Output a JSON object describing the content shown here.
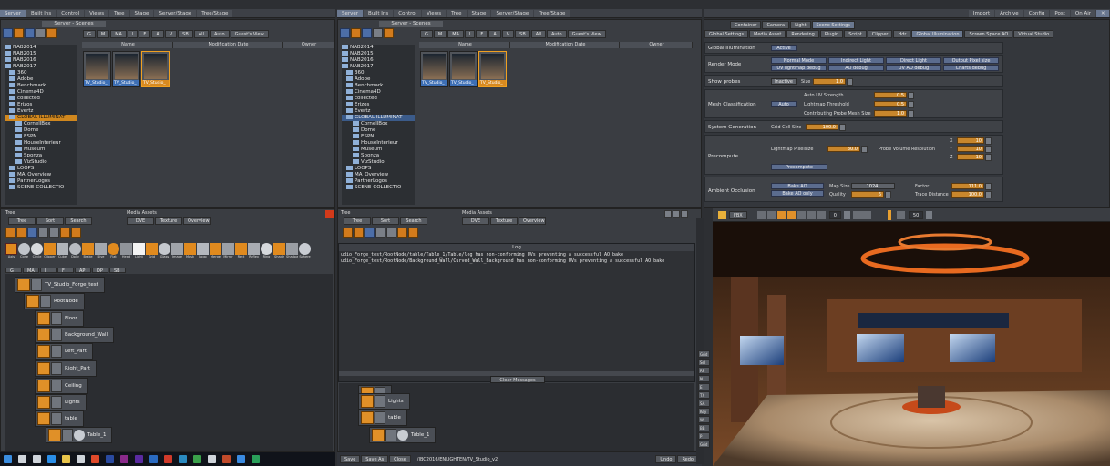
{
  "left_menubar": {
    "tabs": [
      "Server",
      "Built Ins",
      "Control",
      "Views",
      "Tree",
      "Stage",
      "Server/Stage",
      "Tree/Stage"
    ]
  },
  "mid_menubar": {
    "tabs": [
      "Server",
      "Built Ins",
      "Control",
      "Views",
      "Tree",
      "Stage",
      "Server/Stage",
      "Tree/Stage"
    ]
  },
  "right_menubar": {
    "tabs": [
      "Import",
      "Archive",
      "Config",
      "Post",
      "On Air"
    ]
  },
  "server_panel": {
    "title": "Server - Scenes",
    "filter_buttons": [
      "G",
      "M",
      "MA",
      "I",
      "F",
      "A",
      "V",
      "SB",
      "All",
      "Auto",
      "Guest's View"
    ],
    "columns": [
      "Name",
      "Modification Date",
      "Owner"
    ],
    "tree": [
      "NAB2014",
      "NAB2015",
      "NAB2016",
      "NAB2017",
      "360",
      "Adobe",
      "Benchmark",
      "Cinema4D",
      "collected",
      "Erizos",
      "Evertz",
      "GLOBAL ILLUMINAT",
      "CornellBox",
      "Dome",
      "ESPN",
      "HouseInterieur",
      "Museum",
      "Sponza",
      "VizStudio",
      "LOOPS",
      "MA_Overview",
      "PartnerLogos",
      "SCENE-COLLECTIO"
    ],
    "thumbs": [
      "TV_Studio_",
      "TV_Studio_",
      "TV_Studio_"
    ]
  },
  "tree_panel": {
    "label": "Tree",
    "buttons": [
      "Tree",
      "Sort",
      "Search"
    ],
    "media_label": "Media Assets",
    "media_buttons": [
      "DVE",
      "Texture",
      "Overview"
    ],
    "plugins": [
      "Axis",
      "Cone",
      "Circle",
      "Clipper",
      "Cube",
      "Dolly",
      "Brake",
      "Dive",
      "Flat",
      "Head",
      "Light",
      "Grid",
      "Glass",
      "Image",
      "Mask",
      "Logo",
      "Merge",
      "Mirror",
      "Rect",
      "Reflex",
      "Ring",
      "Shade",
      "Shadow",
      "Sphere"
    ],
    "tabs": [
      "G",
      "MA",
      "I",
      "F",
      "AP",
      "DP",
      "SB"
    ],
    "nodes": [
      "TV_Studio_Forge_test",
      "RootNode",
      "Floor",
      "Background_Wall",
      "Left_Part",
      "Right_Part",
      "Ceiling",
      "Lights",
      "table",
      "Table_1"
    ]
  },
  "log_panel": {
    "title": "Log",
    "lines": [
      "udio_Forge_test/RootNode/table/Table_1/Table/leg has non-conforming UVs preventing a successful AO bake",
      "udio_Forge_test/RootNode/Background_Wall/Curved_Wall_Background has non-conforming UVs preventing a successful AO bake"
    ],
    "clear_label": "Clear Messages",
    "bottom_nodes": [
      "Lights",
      "table",
      "Table_1"
    ],
    "status_buttons": [
      "Save",
      "Save As",
      "Close"
    ],
    "path": "/IBC2016/ENLIGHTEN/TV_Studio_v2",
    "undo": "Undo",
    "redo": "Redo"
  },
  "settings_panel": {
    "top_tabs": [
      "Container",
      "Camera",
      "Light",
      "Scene Settings"
    ],
    "sub_tabs": [
      "Global Settings",
      "Media Asset",
      "Rendering",
      "Plugin",
      "Script",
      "Clipper",
      "Hdr",
      "Global Illumination",
      "Screen Space AO",
      "Virtual Studio"
    ],
    "gi_label": "Global Illumination",
    "gi_value": "Active",
    "render_mode_label": "Render Mode",
    "render_modes": [
      "Normal Mode",
      "Indirect Light",
      "Direct Light",
      "Output Pixel size",
      "UV lightmap debug",
      "AO debug",
      "UV AO debug",
      "Charts debug"
    ],
    "probes_label": "Show probes",
    "probes_value": "Inactive",
    "size_label": "Size",
    "size_value": "1.0",
    "mesh_label": "Mesh Classification",
    "mesh_value": "Auto",
    "auto_uv_label": "Auto UV Strength",
    "auto_uv_value": "0.5",
    "lightmap_thresh_label": "Lightmap Threshold",
    "lightmap_thresh_value": "0.5",
    "probe_mesh_label": "Contributing Probe Mesh Size",
    "probe_mesh_value": "1.0",
    "sysgen_label": "System Generation",
    "grid_label": "Grid Cell Size",
    "grid_value": "100.0",
    "precompute_label": "Precompute",
    "pixelsize_label": "Lightmap Pixelsize",
    "pixelsize_value": "30.0",
    "probe_res_label": "Probe Volume Resolution",
    "xyz_labels": [
      "X",
      "Y",
      "Z"
    ],
    "xyz_values": [
      "10",
      "10",
      "10"
    ],
    "precompute_btn": "Precompute",
    "ao_label": "Ambient Occlusion",
    "bake_ao": "Bake AO",
    "bake_ao_only": "Bake AO only",
    "map_size_label": "Map Size",
    "map_size_value": "1024",
    "quality_label": "Quality",
    "quality_value": "6",
    "factor_label": "Factor",
    "factor_value": "111.0",
    "trace_label": "Trace Distance",
    "trace_value": "100.0"
  },
  "viewport_toolbar": {
    "fps_label": "FBX",
    "frame_value": "0",
    "frame2_value": "50"
  },
  "side_buttons": [
    "Grid",
    "Sel",
    "RP",
    "N",
    "E",
    "TX",
    "SA",
    "Key",
    "W",
    "BB",
    "P",
    "Grid"
  ]
}
